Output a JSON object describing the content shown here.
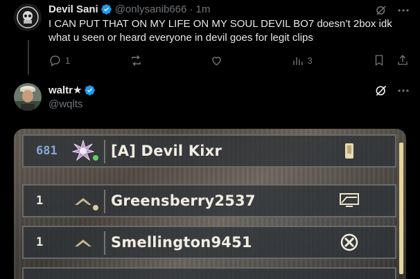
{
  "tweet1": {
    "name": "Devil Sani",
    "handle": "@onlysanib666",
    "time": "· 1m",
    "text": "I CAN PUT THAT ON MY LIFE ON MY SOUL DEVIL BO7 doesn’t 2box idk what u seen or heard everyone in devil goes for legit clips",
    "replies": "1",
    "retweets": "",
    "likes": "",
    "views": "3"
  },
  "tweet2": {
    "name": "waltr★",
    "handle": "@wqlts"
  },
  "media": {
    "rows": [
      {
        "rank": "681",
        "gamertag": "[A] Devil Kixr",
        "emblem": "spiked-star-emblem",
        "status": "online",
        "platform": "mobile-icon"
      },
      {
        "rank": "1",
        "gamertag": "Greensberry2537",
        "emblem": "chevron-rank-emblem",
        "status": "away",
        "platform": "pc-icon"
      },
      {
        "rank": "1",
        "gamertag": "Smellington9451",
        "emblem": "chevron-rank-emblem",
        "status": "online",
        "platform": "xbox-icon"
      }
    ]
  },
  "colors": {
    "accent_blue": "#1d9bf0",
    "muted": "#71767b",
    "online": "#5fd35f",
    "away": "#d9c9a0"
  }
}
